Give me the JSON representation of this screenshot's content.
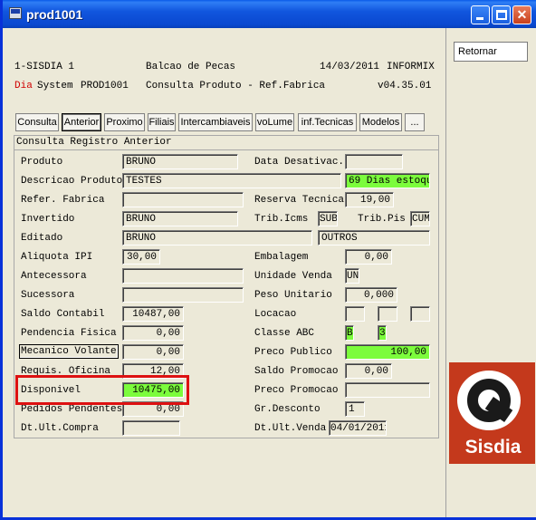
{
  "window": {
    "title": "prod1001"
  },
  "header": {
    "l1_left": "1-SISDIA 1",
    "l1_mid": "Balcao de Pecas",
    "l1_date": "14/03/2011",
    "l1_right": "INFORMIX",
    "l2_dia": "Dia",
    "l2_system": "System",
    "l2_prog": "PROD1001",
    "l2_mid": "Consulta Produto - Ref.Fabrica",
    "l2_right": "v04.35.01"
  },
  "tabs": [
    "Consulta",
    "Anterior",
    "Proximo",
    "Filiais",
    "Intercambiaveis",
    "voLume",
    "inf.Tecnicas",
    "Modelos",
    "..."
  ],
  "status_line": "Consulta Registro Anterior",
  "right": {
    "retornar": "Retornar",
    "logo_text": "Sisdia"
  },
  "left_fields": [
    {
      "label": "Produto",
      "value": "BRUNO"
    },
    {
      "label": "Descricao Produto",
      "value": "TESTES"
    },
    {
      "label": "Refer. Fabrica",
      "value": ""
    },
    {
      "label": "Invertido",
      "value": "BRUNO"
    },
    {
      "label": "Editado",
      "value": "BRUNO"
    },
    {
      "label": "Aliquota IPI",
      "value": "30,00"
    },
    {
      "label": "Antecessora",
      "value": ""
    },
    {
      "label": "Sucessora",
      "value": ""
    },
    {
      "label": "Saldo Contabil",
      "value": "10487,00"
    },
    {
      "label": "Pendencia Fisica",
      "value": "0,00"
    },
    {
      "label": "Mecanico Volante",
      "value": "0,00"
    },
    {
      "label": "Requis. Oficina",
      "value": "12,00"
    },
    {
      "label": "Disponivel",
      "value": "10475,00"
    },
    {
      "label": "Pedidos Pendentes",
      "value": "0,00"
    },
    {
      "label": "Dt.Ult.Compra",
      "value": ""
    }
  ],
  "right_fields": {
    "data_desativac_label": "Data Desativac.",
    "data_desativac": "",
    "dias_estoque": "69 Dias estoque",
    "reserva_tecnica_label": "Reserva Tecnica",
    "reserva_tecnica": "19,00",
    "trib_icms_label": "Trib.Icms",
    "trib_icms": "SUB",
    "trib_pis_label": "Trib.Pis",
    "trib_pis": "CUM",
    "editado_right": "OUTROS",
    "embalagem_label": "Embalagem",
    "embalagem": "0,00",
    "unidade_venda_label": "Unidade Venda",
    "unidade_venda": "UN",
    "peso_unitario_label": "Peso Unitario",
    "peso_unitario": "0,000",
    "locacao_label": "Locacao",
    "classe_abc_label": "Classe ABC",
    "classe_a": "B",
    "classe_b": "3",
    "preco_publico_label": "Preco Publico",
    "preco_publico": "100,00",
    "saldo_promocao_label": "Saldo Promocao",
    "saldo_promocao": "0,00",
    "preco_promocao_label": "Preco Promocao",
    "preco_promocao": "",
    "gr_desconto_label": "Gr.Desconto",
    "gr_desconto": "1",
    "dt_ult_venda_label": "Dt.Ult.Venda",
    "dt_ult_venda": "04/01/2011"
  },
  "colors": {
    "highlight_green": "#7cfc3c",
    "annotation_red": "#dd1111",
    "title_blue": "#0a48d0"
  }
}
